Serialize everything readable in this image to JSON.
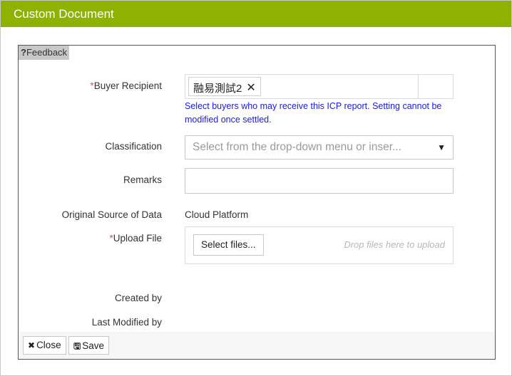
{
  "window": {
    "title": "Custom Document"
  },
  "feedback": {
    "label": "Feedback",
    "icon": "question-mark-icon"
  },
  "form": {
    "buyer_recipient": {
      "label": "Buyer Recipient",
      "required_marker": "*",
      "selected": [
        "融易測試2"
      ],
      "remove_icon": "close-icon",
      "hint": "Select buyers who may receive this ICP report. Setting cannot be modified once settled."
    },
    "classification": {
      "label": "Classification",
      "placeholder": "Select from the drop-down menu or inser...",
      "caret_icon": "caret-down-icon"
    },
    "remarks": {
      "label": "Remarks",
      "value": ""
    },
    "original_source": {
      "label": "Original Source of Data",
      "value": "Cloud Platform"
    },
    "upload_file": {
      "label": "Upload File",
      "required_marker": "*",
      "button_label": "Select files...",
      "drop_hint": "Drop files here to upload"
    },
    "created_by": {
      "label": "Created by",
      "value": ""
    },
    "last_modified_by": {
      "label": "Last Modified by",
      "value": ""
    }
  },
  "footer": {
    "close_label": "Close",
    "close_icon": "close-icon",
    "save_label": "Save",
    "save_icon": "floppy-disk-icon"
  },
  "colors": {
    "titlebar": "#8db300",
    "required": "#d9534f",
    "hint": "#1a1adf",
    "placeholder": "#9a9a9a"
  }
}
